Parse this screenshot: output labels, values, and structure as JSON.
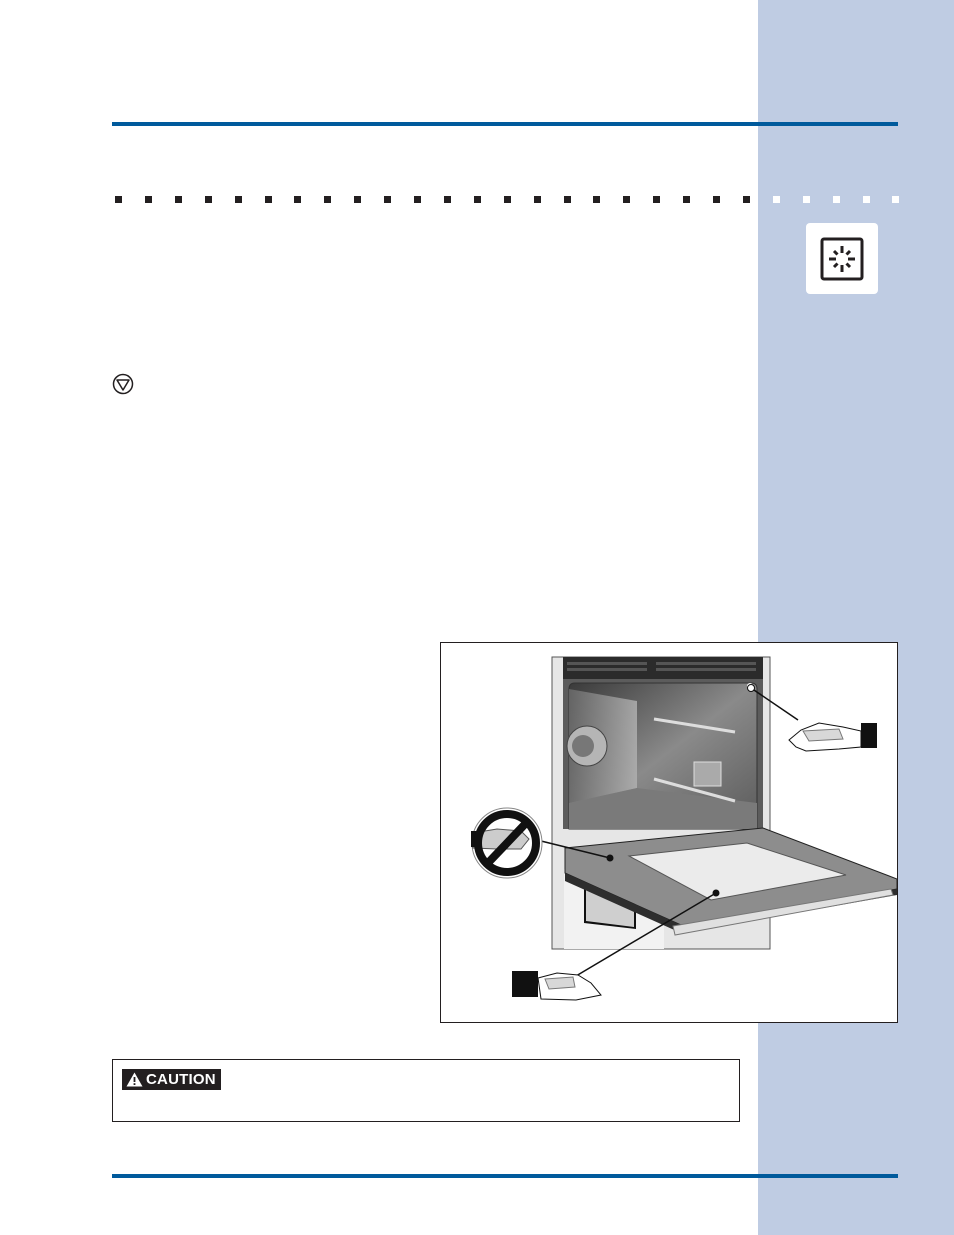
{
  "page": {
    "accent_color": "#005a9c",
    "sidebar_color": "#bfcce3"
  },
  "sidebar": {
    "icon": "self-clean-sparkle-icon"
  },
  "body": {
    "note_icon": "stop-triangle-circle-icon"
  },
  "figure": {
    "subject": "oven-door-open-cleaning-illustration",
    "callouts": [
      {
        "icon": "hand-with-cloth-icon",
        "target": "oven-front-frame"
      },
      {
        "icon": "no-hand-cleaning-icon",
        "target": "door-gasket"
      },
      {
        "icon": "hand-with-cloth-icon",
        "target": "door-inner-panel"
      }
    ]
  },
  "caution": {
    "icon": "warning-triangle-icon",
    "label": "CAUTION",
    "text": ""
  }
}
